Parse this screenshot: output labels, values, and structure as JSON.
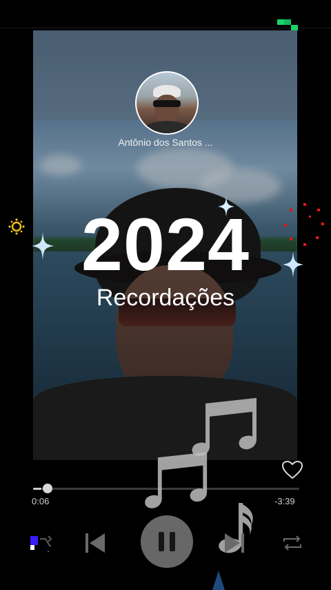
{
  "artist": {
    "name": "Antônio dos Santos ..."
  },
  "artwork": {
    "year_text": "2024",
    "subtitle_text": "Recordações"
  },
  "player": {
    "elapsed": "0:06",
    "remaining": "-3:39",
    "progress_fraction": 0.03,
    "state": "playing"
  },
  "controls": {
    "shuffle_icon": "shuffle-icon",
    "previous_icon": "skip-previous-icon",
    "pause_icon": "pause-icon",
    "next_icon": "skip-next-icon",
    "repeat_icon": "repeat-icon",
    "like_icon": "heart-icon"
  },
  "colors": {
    "background": "#000000",
    "accent_green": "#19d46a",
    "shuffle_indicator": "#3b1cff",
    "fireworks": "#e01818",
    "sun": "#f0c020",
    "sparkle": "#bfe4ff"
  }
}
